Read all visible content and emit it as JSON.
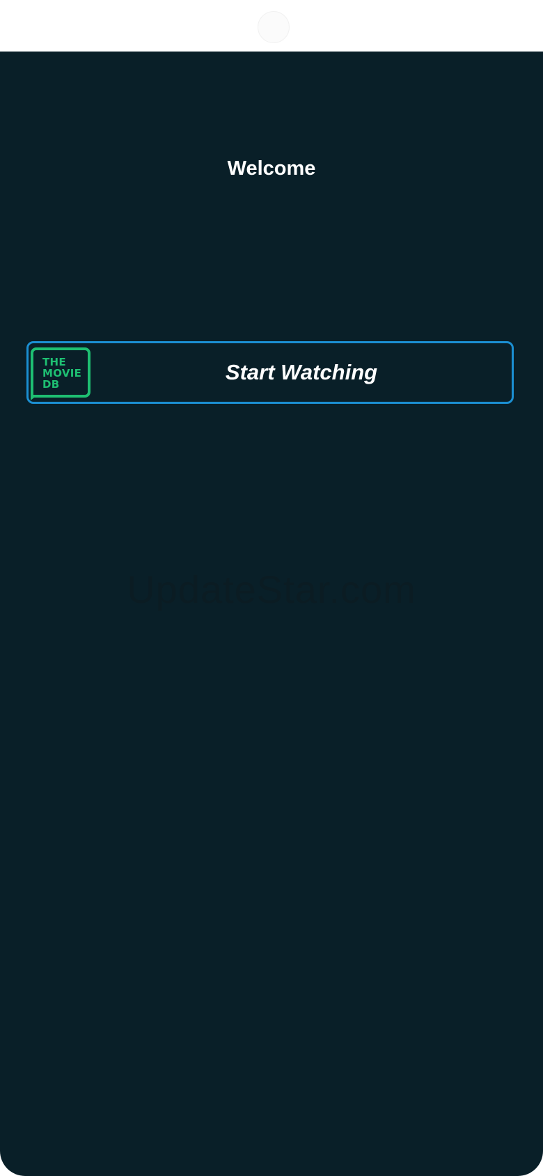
{
  "app": {
    "welcome_title": "Welcome"
  },
  "start_button": {
    "label": "Start Watching",
    "logo_text": "THE\nMOVIE\nDB"
  },
  "watermark": {
    "text": "UpdateStar.com"
  },
  "colors": {
    "background": "#091f28",
    "button_border": "#1b8fd2",
    "logo_green": "#1ebf72",
    "text": "#ffffff"
  },
  "icons": {
    "logo": "tmdb-logo"
  }
}
